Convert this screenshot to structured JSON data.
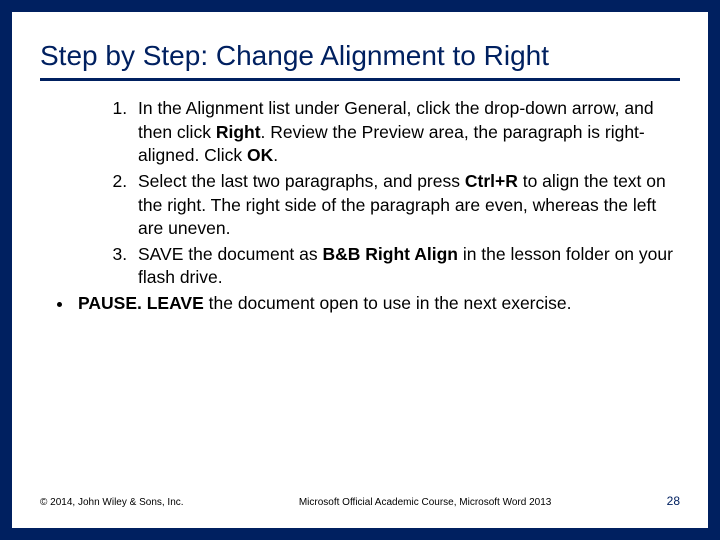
{
  "title": "Step by Step: Change Alignment to Right",
  "steps": {
    "s1": {
      "a": "In the Alignment list under General, click the drop-down arrow, and then click ",
      "b": "Right",
      "c": ". Review the Preview area, the paragraph is right-aligned. Click ",
      "d": "OK",
      "e": "."
    },
    "s2": {
      "a": "Select the last two paragraphs, and press ",
      "b": "Ctrl+R",
      "c": " to align the text on the right. The right side of the paragraph are even, whereas the left are uneven."
    },
    "s3": {
      "a": " SAVE the document as ",
      "b": "B&B Right Align",
      "c": " in the lesson folder on your flash drive."
    }
  },
  "bullet": {
    "a": "PAUSE. LEAVE",
    "b": " the document open to use in the next exercise."
  },
  "footer": {
    "left": "© 2014, John Wiley & Sons, Inc.",
    "center": "Microsoft Official Academic Course, Microsoft Word 2013",
    "right": "28"
  }
}
